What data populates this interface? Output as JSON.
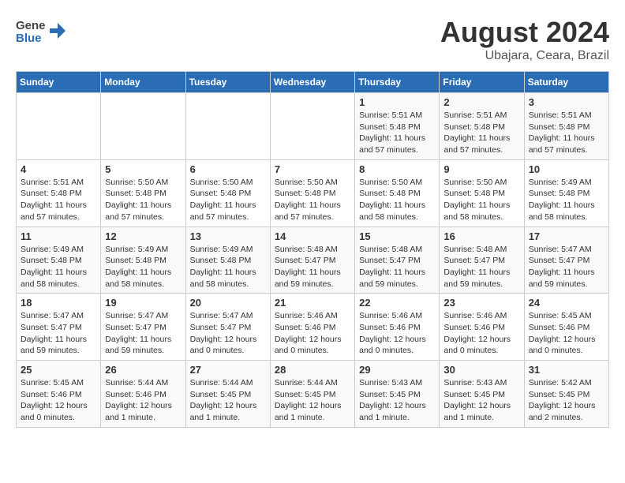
{
  "header": {
    "logo_general": "General",
    "logo_blue": "Blue",
    "month_year": "August 2024",
    "location": "Ubajara, Ceara, Brazil"
  },
  "days_of_week": [
    "Sunday",
    "Monday",
    "Tuesday",
    "Wednesday",
    "Thursday",
    "Friday",
    "Saturday"
  ],
  "weeks": [
    [
      {
        "day": "",
        "sunrise": "",
        "sunset": "",
        "daylight": ""
      },
      {
        "day": "",
        "sunrise": "",
        "sunset": "",
        "daylight": ""
      },
      {
        "day": "",
        "sunrise": "",
        "sunset": "",
        "daylight": ""
      },
      {
        "day": "",
        "sunrise": "",
        "sunset": "",
        "daylight": ""
      },
      {
        "day": "1",
        "sunrise": "Sunrise: 5:51 AM",
        "sunset": "Sunset: 5:48 PM",
        "daylight": "Daylight: 11 hours and 57 minutes."
      },
      {
        "day": "2",
        "sunrise": "Sunrise: 5:51 AM",
        "sunset": "Sunset: 5:48 PM",
        "daylight": "Daylight: 11 hours and 57 minutes."
      },
      {
        "day": "3",
        "sunrise": "Sunrise: 5:51 AM",
        "sunset": "Sunset: 5:48 PM",
        "daylight": "Daylight: 11 hours and 57 minutes."
      }
    ],
    [
      {
        "day": "4",
        "sunrise": "Sunrise: 5:51 AM",
        "sunset": "Sunset: 5:48 PM",
        "daylight": "Daylight: 11 hours and 57 minutes."
      },
      {
        "day": "5",
        "sunrise": "Sunrise: 5:50 AM",
        "sunset": "Sunset: 5:48 PM",
        "daylight": "Daylight: 11 hours and 57 minutes."
      },
      {
        "day": "6",
        "sunrise": "Sunrise: 5:50 AM",
        "sunset": "Sunset: 5:48 PM",
        "daylight": "Daylight: 11 hours and 57 minutes."
      },
      {
        "day": "7",
        "sunrise": "Sunrise: 5:50 AM",
        "sunset": "Sunset: 5:48 PM",
        "daylight": "Daylight: 11 hours and 57 minutes."
      },
      {
        "day": "8",
        "sunrise": "Sunrise: 5:50 AM",
        "sunset": "Sunset: 5:48 PM",
        "daylight": "Daylight: 11 hours and 58 minutes."
      },
      {
        "day": "9",
        "sunrise": "Sunrise: 5:50 AM",
        "sunset": "Sunset: 5:48 PM",
        "daylight": "Daylight: 11 hours and 58 minutes."
      },
      {
        "day": "10",
        "sunrise": "Sunrise: 5:49 AM",
        "sunset": "Sunset: 5:48 PM",
        "daylight": "Daylight: 11 hours and 58 minutes."
      }
    ],
    [
      {
        "day": "11",
        "sunrise": "Sunrise: 5:49 AM",
        "sunset": "Sunset: 5:48 PM",
        "daylight": "Daylight: 11 hours and 58 minutes."
      },
      {
        "day": "12",
        "sunrise": "Sunrise: 5:49 AM",
        "sunset": "Sunset: 5:48 PM",
        "daylight": "Daylight: 11 hours and 58 minutes."
      },
      {
        "day": "13",
        "sunrise": "Sunrise: 5:49 AM",
        "sunset": "Sunset: 5:48 PM",
        "daylight": "Daylight: 11 hours and 58 minutes."
      },
      {
        "day": "14",
        "sunrise": "Sunrise: 5:48 AM",
        "sunset": "Sunset: 5:47 PM",
        "daylight": "Daylight: 11 hours and 59 minutes."
      },
      {
        "day": "15",
        "sunrise": "Sunrise: 5:48 AM",
        "sunset": "Sunset: 5:47 PM",
        "daylight": "Daylight: 11 hours and 59 minutes."
      },
      {
        "day": "16",
        "sunrise": "Sunrise: 5:48 AM",
        "sunset": "Sunset: 5:47 PM",
        "daylight": "Daylight: 11 hours and 59 minutes."
      },
      {
        "day": "17",
        "sunrise": "Sunrise: 5:47 AM",
        "sunset": "Sunset: 5:47 PM",
        "daylight": "Daylight: 11 hours and 59 minutes."
      }
    ],
    [
      {
        "day": "18",
        "sunrise": "Sunrise: 5:47 AM",
        "sunset": "Sunset: 5:47 PM",
        "daylight": "Daylight: 11 hours and 59 minutes."
      },
      {
        "day": "19",
        "sunrise": "Sunrise: 5:47 AM",
        "sunset": "Sunset: 5:47 PM",
        "daylight": "Daylight: 11 hours and 59 minutes."
      },
      {
        "day": "20",
        "sunrise": "Sunrise: 5:47 AM",
        "sunset": "Sunset: 5:47 PM",
        "daylight": "Daylight: 12 hours and 0 minutes."
      },
      {
        "day": "21",
        "sunrise": "Sunrise: 5:46 AM",
        "sunset": "Sunset: 5:46 PM",
        "daylight": "Daylight: 12 hours and 0 minutes."
      },
      {
        "day": "22",
        "sunrise": "Sunrise: 5:46 AM",
        "sunset": "Sunset: 5:46 PM",
        "daylight": "Daylight: 12 hours and 0 minutes."
      },
      {
        "day": "23",
        "sunrise": "Sunrise: 5:46 AM",
        "sunset": "Sunset: 5:46 PM",
        "daylight": "Daylight: 12 hours and 0 minutes."
      },
      {
        "day": "24",
        "sunrise": "Sunrise: 5:45 AM",
        "sunset": "Sunset: 5:46 PM",
        "daylight": "Daylight: 12 hours and 0 minutes."
      }
    ],
    [
      {
        "day": "25",
        "sunrise": "Sunrise: 5:45 AM",
        "sunset": "Sunset: 5:46 PM",
        "daylight": "Daylight: 12 hours and 0 minutes."
      },
      {
        "day": "26",
        "sunrise": "Sunrise: 5:44 AM",
        "sunset": "Sunset: 5:46 PM",
        "daylight": "Daylight: 12 hours and 1 minute."
      },
      {
        "day": "27",
        "sunrise": "Sunrise: 5:44 AM",
        "sunset": "Sunset: 5:45 PM",
        "daylight": "Daylight: 12 hours and 1 minute."
      },
      {
        "day": "28",
        "sunrise": "Sunrise: 5:44 AM",
        "sunset": "Sunset: 5:45 PM",
        "daylight": "Daylight: 12 hours and 1 minute."
      },
      {
        "day": "29",
        "sunrise": "Sunrise: 5:43 AM",
        "sunset": "Sunset: 5:45 PM",
        "daylight": "Daylight: 12 hours and 1 minute."
      },
      {
        "day": "30",
        "sunrise": "Sunrise: 5:43 AM",
        "sunset": "Sunset: 5:45 PM",
        "daylight": "Daylight: 12 hours and 1 minute."
      },
      {
        "day": "31",
        "sunrise": "Sunrise: 5:42 AM",
        "sunset": "Sunset: 5:45 PM",
        "daylight": "Daylight: 12 hours and 2 minutes."
      }
    ]
  ]
}
